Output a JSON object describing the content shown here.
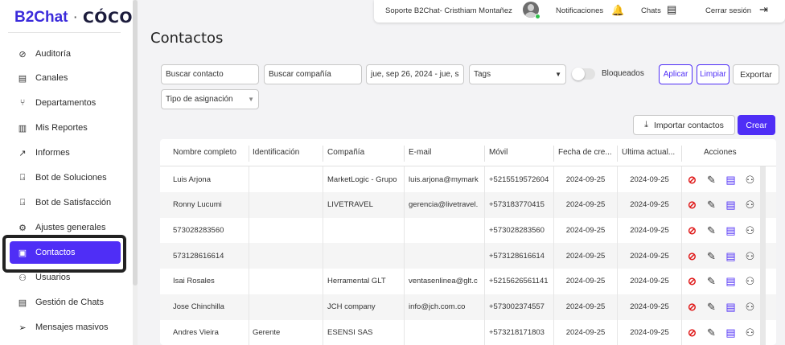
{
  "brand": {
    "left": "B2Chat",
    "separator": "·",
    "right": "CÓCO"
  },
  "sidebar": {
    "items": [
      {
        "label": "Auditoría",
        "icon": "check-circle-icon",
        "glyph": "⊘"
      },
      {
        "label": "Canales",
        "icon": "channels-icon",
        "glyph": "▤"
      },
      {
        "label": "Departamentos",
        "icon": "departments-icon",
        "glyph": "⑂"
      },
      {
        "label": "Mis Reportes",
        "icon": "reports-icon",
        "glyph": "▥"
      },
      {
        "label": "Informes",
        "icon": "trend-icon",
        "glyph": "↗"
      },
      {
        "label": "Bot de Soluciones",
        "icon": "bot-icon",
        "glyph": "⍈"
      },
      {
        "label": "Bot de Satisfacción",
        "icon": "bot-icon",
        "glyph": "⍈"
      },
      {
        "label": "Ajustes generales",
        "icon": "gear-icon",
        "glyph": "⚙"
      },
      {
        "label": "Contactos",
        "icon": "contacts-icon",
        "glyph": "▣"
      },
      {
        "label": "Usuarios",
        "icon": "users-icon",
        "glyph": "⚇"
      },
      {
        "label": "Gestión de Chats",
        "icon": "chat-icon",
        "glyph": "▤"
      },
      {
        "label": "Mensajes masivos",
        "icon": "send-icon",
        "glyph": "➢"
      }
    ]
  },
  "topbar": {
    "user": "Soporte B2Chat- Cristhiam Montañez",
    "notifications": "Notificaciones",
    "chats": "Chats",
    "logout": "Cerrar sesión"
  },
  "page": {
    "title": "Contactos"
  },
  "filters": {
    "search_contact": "Buscar contacto",
    "search_company": "Buscar compañía",
    "date_range": "jue, sep 26, 2024 - jue, s",
    "tags": "Tags",
    "blocked": "Bloqueados",
    "apply": "Aplicar",
    "clear": "Limpiar",
    "export": "Exportar",
    "assignment_type": "Tipo de asignación",
    "import": "Importar contactos",
    "create": "Crear"
  },
  "table": {
    "headers": [
      "Nombre completo",
      "Identificación",
      "Compañía",
      "E-mail",
      "Móvil",
      "Fecha de cre...",
      "Última actual...",
      "Acciones"
    ],
    "rows": [
      {
        "name": "Luis Arjona",
        "id": "",
        "company": "MarketLogic - Grupo",
        "email": "luis.arjona@mymark",
        "mobile": "+5215519572604",
        "created": "2024-09-25",
        "updated": "2024-09-25"
      },
      {
        "name": "Ronny Lucumi",
        "id": "",
        "company": "LIVETRAVEL",
        "email": "gerencia@livetravel.",
        "mobile": "+573183770415",
        "created": "2024-09-25",
        "updated": "2024-09-25"
      },
      {
        "name": "573028283560",
        "id": "",
        "company": "",
        "email": "",
        "mobile": "+573028283560",
        "created": "2024-09-25",
        "updated": "2024-09-25"
      },
      {
        "name": "573128616614",
        "id": "",
        "company": "",
        "email": "",
        "mobile": "+573128616614",
        "created": "2024-09-25",
        "updated": "2024-09-25"
      },
      {
        "name": "Isai Rosales",
        "id": "",
        "company": "Herramental GLT",
        "email": "ventasenlinea@glt.c",
        "mobile": "+5215626561141",
        "created": "2024-09-25",
        "updated": "2024-09-25"
      },
      {
        "name": "Jose Chinchilla",
        "id": "",
        "company": "JCH company",
        "email": "info@jch.com.co",
        "mobile": "+573002374557",
        "created": "2024-09-25",
        "updated": "2024-09-25"
      },
      {
        "name": "Andres Vieira",
        "id": "Gerente",
        "company": "ESENSI SAS",
        "email": "",
        "mobile": "+573218171803",
        "created": "2024-09-25",
        "updated": "2024-09-25"
      }
    ]
  },
  "colors": {
    "accent": "#4f2ef6",
    "danger": "#e01e1e"
  }
}
